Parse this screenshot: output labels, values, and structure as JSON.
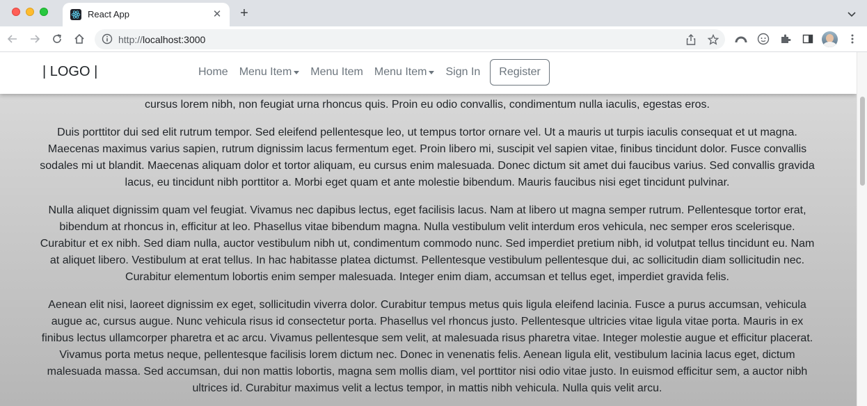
{
  "browser": {
    "tab_title": "React App",
    "url_scheme": "http://",
    "url_host": "localhost:3000"
  },
  "navbar": {
    "logo": "| LOGO |",
    "links": [
      {
        "label": "Home"
      },
      {
        "label": "Menu Item"
      },
      {
        "label": "Menu Item"
      },
      {
        "label": "Menu Item"
      },
      {
        "label": "Sign In"
      }
    ],
    "register_label": "Register"
  },
  "content": {
    "partial_top": "consectetur porta metus. Vivamus sagittis odio at vehicula gravida. Vestibulum suscipit ornare pretium. Vestibulum viverra nisl vel pretium vulputate. Integer cursus lorem nibh, non feugiat urna rhoncus quis. Proin eu odio convallis, condimentum nulla iaculis, egestas eros.",
    "paragraphs": [
      "Duis porttitor dui sed elit rutrum tempor. Sed eleifend pellentesque leo, ut tempus tortor ornare vel. Ut a mauris ut turpis iaculis consequat et ut magna. Maecenas maximus varius sapien, rutrum dignissim lacus fermentum eget. Proin libero mi, suscipit vel sapien vitae, finibus tincidunt dolor. Fusce convallis sodales mi ut blandit. Maecenas aliquam dolor et tortor aliquam, eu cursus enim malesuada. Donec dictum sit amet dui faucibus varius. Sed convallis gravida lacus, eu tincidunt nibh porttitor a. Morbi eget quam et ante molestie bibendum. Mauris faucibus nisi eget tincidunt pulvinar.",
      "Nulla aliquet dignissim quam vel feugiat. Vivamus nec dapibus lectus, eget facilisis lacus. Nam at libero ut magna semper rutrum. Pellentesque tortor erat, bibendum at rhoncus in, efficitur at leo. Phasellus vitae bibendum magna. Nulla vestibulum velit interdum eros vehicula, nec semper eros scelerisque. Curabitur et ex nibh. Sed diam nulla, auctor vestibulum nibh ut, condimentum commodo nunc. Sed imperdiet pretium nibh, id volutpat tellus tincidunt eu. Nam at aliquet libero. Vestibulum at erat tellus. In hac habitasse platea dictumst. Pellentesque vestibulum pellentesque dui, ac sollicitudin diam sollicitudin nec. Curabitur elementum lobortis enim semper malesuada. Integer enim diam, accumsan et tellus eget, imperdiet gravida felis.",
      "Aenean elit nisi, laoreet dignissim ex eget, sollicitudin viverra dolor. Curabitur tempus metus quis ligula eleifend lacinia. Fusce a purus accumsan, vehicula augue ac, cursus augue. Nunc vehicula risus id consectetur porta. Phasellus vel rhoncus justo. Pellentesque ultricies vitae ligula vitae porta. Mauris in ex finibus lectus ullamcorper pharetra et ac arcu. Vivamus pellentesque sem velit, at malesuada risus pharetra vitae. Integer molestie augue et efficitur placerat. Vivamus porta metus neque, pellentesque facilisis lorem dictum nec. Donec in venenatis felis. Aenean ligula elit, vestibulum lacinia lacus eget, dictum malesuada massa. Sed accumsan, dui non mattis lobortis, magna sem mollis diam, vel porttitor nisi odio vitae justo. In euismod efficitur sem, a auctor nibh ultrices id. Curabitur maximus velit a lectus tempor, in mattis nibh vehicula. Nulla quis velit arcu."
    ]
  }
}
